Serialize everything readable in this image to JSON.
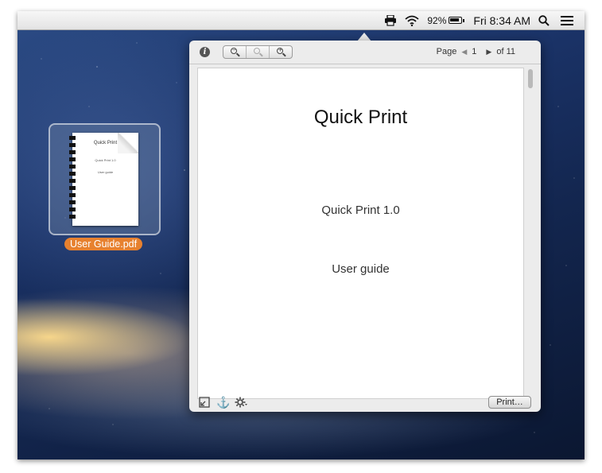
{
  "menubar": {
    "battery_percent": "92%",
    "battery_level": 0.92,
    "clock": "Fri 8:34 AM",
    "icons": [
      "printer-icon",
      "wifi-icon",
      "battery-icon",
      "spotlight-search-icon",
      "notification-center-icon"
    ]
  },
  "desktop": {
    "file_name": "User Guide.pdf",
    "thumbnail": {
      "title": "Quick Print",
      "line1": "Quick Print 1.0",
      "line2": "User guide"
    }
  },
  "popover": {
    "toolbar": {
      "page_label": "Page",
      "current_page": "1",
      "of_label": "of 11"
    },
    "document": {
      "title": "Quick Print",
      "line1": "Quick Print 1.0",
      "line2": "User guide"
    },
    "print_button": "Print…"
  }
}
